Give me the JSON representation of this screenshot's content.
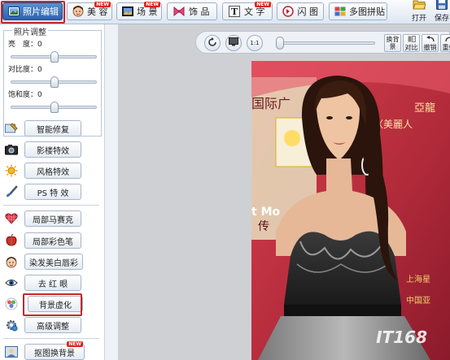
{
  "toolbar": {
    "photo_edit": "照片编辑",
    "beauty": "美 容",
    "scene": "场 景",
    "accessory": "饰 品",
    "text": "文 字",
    "flash": "闪 图",
    "collage": "多图拼贴",
    "open": "打开",
    "save": "保存",
    "hot_badge": "NEW"
  },
  "adjust": {
    "title": "照片调整",
    "brightness_label": "亮　度：",
    "brightness_value": "0",
    "contrast_label": "对比度：",
    "contrast_value": "0",
    "saturation_label": "饱和度：",
    "saturation_value": "0"
  },
  "tools": [
    "智能修复",
    "影楼特效",
    "风格特效",
    "PS 特 效",
    "局部马赛克",
    "局部彩色笔",
    "染发美白唇彩",
    "去 红 眼",
    "背景虚化",
    "高级调整",
    "抠图换背景"
  ],
  "canvas": {
    "btn_bg": "换背景",
    "btn_compare": "对比",
    "btn_undo": "撤销",
    "btn_redo": "重做",
    "watermark": "IT168",
    "photo_text_1": "国际广",
    "photo_text_2": "〈美麗人",
    "photo_text_3": "亞龍",
    "photo_text_4": "传",
    "photo_text_5": "t Mo",
    "photo_text_6": "中国亚",
    "photo_text_7": "上海星"
  },
  "colors": {
    "accent": "#2d63ad",
    "highlight_box": "#c0282d",
    "photo_bg": "#b0283a"
  }
}
